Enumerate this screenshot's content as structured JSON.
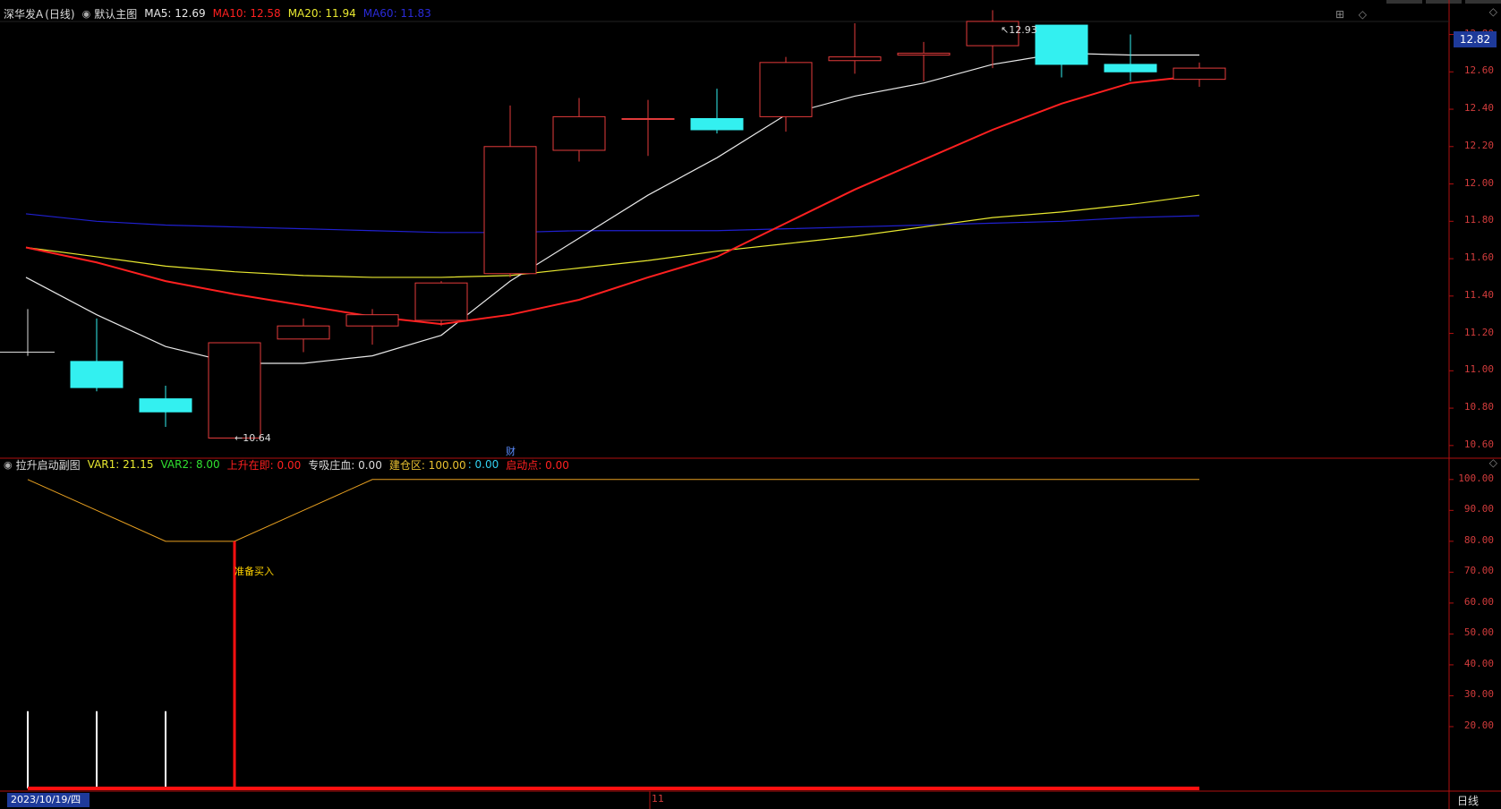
{
  "main_header": {
    "stock_name": "深华发A",
    "period": "(日线)",
    "chart_name": "默认主图",
    "ma5": "MA5: 12.69",
    "ma10": "MA10: 12.58",
    "ma20": "MA20: 11.94",
    "ma60": "MA60: 11.83"
  },
  "sub_header": {
    "indicator_name": "拉升启动副图",
    "var1": "VAR1: 21.15",
    "var2": "VAR2: 8.00",
    "rising": "上升在即: 0.00",
    "absorb": "专吸庄血: 0.00",
    "position_zone_label": "建仓区: 100.00",
    "position_zone_value": ": 0.00",
    "launch_point": "启动点: 0.00"
  },
  "price_axis": [
    "12.80",
    "12.60",
    "12.40",
    "12.20",
    "12.00",
    "11.80",
    "11.60",
    "11.40",
    "11.20",
    "11.00",
    "10.80",
    "10.60"
  ],
  "sub_axis": [
    "100.00",
    "90.00",
    "80.00",
    "70.00",
    "60.00",
    "50.00",
    "40.00",
    "30.00",
    "20.00"
  ],
  "current_price": "12.82",
  "high_marker": "12.93",
  "low_marker": "10.64",
  "financial_icon": "财",
  "buy_signal": "准备买入",
  "date_label": "2023/10/19/四",
  "month_label": "11",
  "period_label": "日线",
  "colors": {
    "up": "#e33b3b",
    "down": "#33f0f0",
    "ma5": "#e8e8e8",
    "ma10": "#ff2020",
    "ma20": "#e8e830",
    "ma60": "#2020d0",
    "axis": "#b01010"
  },
  "chart_data": {
    "type": "candlestick",
    "candles": [
      {
        "o": 11.1,
        "c": 11.1,
        "h": 11.33,
        "l": 11.08
      },
      {
        "o": 11.05,
        "c": 10.91,
        "h": 11.28,
        "l": 10.89
      },
      {
        "o": 10.85,
        "c": 10.78,
        "h": 10.92,
        "l": 10.7
      },
      {
        "o": 10.64,
        "c": 11.15,
        "h": 11.15,
        "l": 10.64
      },
      {
        "o": 11.17,
        "c": 11.24,
        "h": 11.28,
        "l": 11.1
      },
      {
        "o": 11.24,
        "c": 11.3,
        "h": 11.33,
        "l": 11.14
      },
      {
        "o": 11.27,
        "c": 11.47,
        "h": 11.48,
        "l": 11.24
      },
      {
        "o": 11.52,
        "c": 12.2,
        "h": 12.42,
        "l": 11.5
      },
      {
        "o": 12.18,
        "c": 12.36,
        "h": 12.46,
        "l": 12.12
      },
      {
        "o": 12.35,
        "c": 12.35,
        "h": 12.45,
        "l": 12.15
      },
      {
        "o": 12.35,
        "c": 12.29,
        "h": 12.51,
        "l": 12.27
      },
      {
        "o": 12.36,
        "c": 12.65,
        "h": 12.68,
        "l": 12.28
      },
      {
        "o": 12.66,
        "c": 12.68,
        "h": 12.86,
        "l": 12.59
      },
      {
        "o": 12.69,
        "c": 12.7,
        "h": 12.76,
        "l": 12.55
      },
      {
        "o": 12.74,
        "c": 12.87,
        "h": 12.93,
        "l": 12.62
      },
      {
        "o": 12.85,
        "c": 12.64,
        "h": 12.85,
        "l": 12.57
      },
      {
        "o": 12.64,
        "c": 12.6,
        "h": 12.8,
        "l": 12.55
      },
      {
        "o": 12.56,
        "c": 12.62,
        "h": 12.65,
        "l": 12.52
      }
    ],
    "ma5": [
      11.5,
      11.3,
      11.13,
      11.04,
      11.04,
      11.08,
      11.19,
      11.48,
      11.71,
      11.94,
      12.14,
      12.37,
      12.47,
      12.54,
      12.64,
      12.7,
      12.69,
      12.69
    ],
    "ma10": [
      11.66,
      11.58,
      11.48,
      11.41,
      11.35,
      11.29,
      11.25,
      11.3,
      11.38,
      11.5,
      11.61,
      11.79,
      11.97,
      12.13,
      12.29,
      12.43,
      12.54,
      12.58
    ],
    "ma20": [
      11.66,
      11.61,
      11.56,
      11.53,
      11.51,
      11.5,
      11.5,
      11.51,
      11.55,
      11.59,
      11.64,
      11.68,
      11.72,
      11.77,
      11.82,
      11.85,
      11.89,
      11.94
    ],
    "ma60": [
      11.84,
      11.8,
      11.78,
      11.77,
      11.76,
      11.75,
      11.74,
      11.74,
      11.75,
      11.75,
      11.75,
      11.76,
      11.77,
      11.78,
      11.79,
      11.8,
      11.82,
      11.83
    ],
    "sub_var1": [
      100,
      90,
      80,
      80,
      90,
      100,
      100,
      100,
      100,
      100,
      100,
      100,
      100,
      100,
      100,
      100,
      100,
      100
    ],
    "sub_white_bars": [
      25,
      25,
      25,
      0,
      0,
      0,
      0,
      0,
      0,
      0,
      0,
      0,
      0,
      0,
      0,
      0,
      0,
      0
    ],
    "sub_red_bar": [
      0,
      0,
      0,
      80,
      0,
      0,
      0,
      0,
      0,
      0,
      0,
      0,
      0,
      0,
      0,
      0,
      0,
      0
    ],
    "price_range": [
      10.58,
      12.86
    ],
    "sub_range": [
      0,
      104
    ]
  }
}
